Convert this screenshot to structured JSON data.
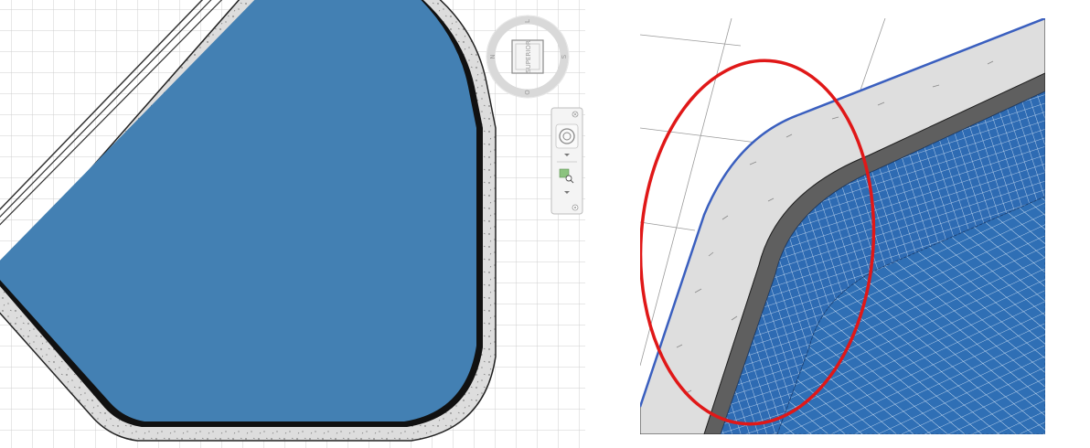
{
  "viewcube": {
    "face_label": "SUPERIOR",
    "compass": {
      "north": "N",
      "south": "S",
      "east": "L",
      "west": "O"
    }
  },
  "colors": {
    "pool_water": "#4380b3",
    "pool_coping": "#dcdcdc",
    "wall_dark": "#6e6e6e",
    "grid_line": "#c8c8c8",
    "highlight_ellipse": "#e01818",
    "tile_grout": "#ffffff",
    "edge_line": "#3a5fbf"
  },
  "icons": [
    "viewcube-icon",
    "steering-wheel-icon",
    "zoom-region-icon",
    "dropdown-arrow-icon",
    "close-icon",
    "settings-icon"
  ]
}
